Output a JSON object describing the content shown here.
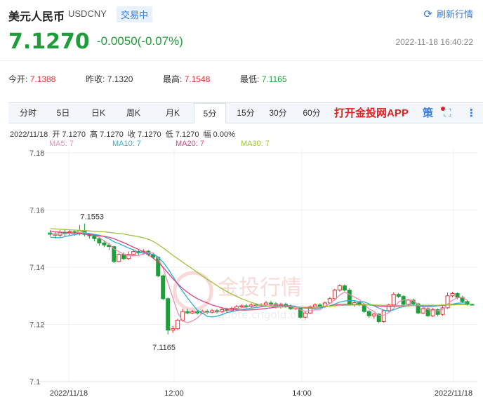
{
  "header": {
    "name": "美元人民币",
    "code": "USDCNY",
    "status": "交易中",
    "refresh_label": "刷新行情",
    "price": "7.1270",
    "change": "-0.0050(-0.07%)",
    "datetime": "2022-11-18 16:40:22"
  },
  "stats": [
    {
      "label": "今开:",
      "value": "7.1388",
      "color": "#e03030"
    },
    {
      "label": "昨收:",
      "value": "7.1320",
      "color": "#333333"
    },
    {
      "label": "最高:",
      "value": "7.1548",
      "color": "#e03030"
    },
    {
      "label": "最低:",
      "value": "7.1165",
      "color": "#1e9e3a"
    }
  ],
  "tabs": [
    "分时",
    "5日",
    "日K",
    "周K",
    "月K",
    "5分",
    "15分",
    "30分",
    "60分"
  ],
  "active_tab": "5分",
  "app_promo": "打开金投网APP",
  "strategy_label": "策",
  "ohlc_line": "2022/11/18  开 7.1270  高 7.1270  收 7.1270  低 7.1270  幅 0.00%",
  "ma_labels": [
    {
      "text": "MA5: 7",
      "color": "#f08cb4"
    },
    {
      "text": "MA10: 7",
      "color": "#27b0d8"
    },
    {
      "text": "MA20: 7",
      "color": "#e0407a"
    },
    {
      "text": "MA30: 7",
      "color": "#9ec23a"
    }
  ],
  "watermark": {
    "main": "金投行情",
    "sub": "quote.cngold.org"
  },
  "chart_data": {
    "type": "candlestick",
    "title": "",
    "y_ticks": [
      "7.18",
      "7.16",
      "7.14",
      "7.12",
      "7.1"
    ],
    "ylim": [
      7.1,
      7.18
    ],
    "x_ticks": [
      "2022/11/18",
      "12:00",
      "14:00",
      "2022/11/18"
    ],
    "annotations": [
      {
        "text": "7.1553",
        "value": 7.1553
      },
      {
        "text": "7.1165",
        "value": 7.1165
      }
    ],
    "up_color": "#e03030",
    "down_color": "#1e9e3a",
    "candles": [
      {
        "o": 7.152,
        "c": 7.1515,
        "h": 7.153,
        "l": 7.1508
      },
      {
        "o": 7.1516,
        "c": 7.1512,
        "h": 7.1525,
        "l": 7.15
      },
      {
        "o": 7.1512,
        "c": 7.1522,
        "h": 7.153,
        "l": 7.1505
      },
      {
        "o": 7.1522,
        "c": 7.1518,
        "h": 7.1532,
        "l": 7.151
      },
      {
        "o": 7.1518,
        "c": 7.1524,
        "h": 7.1532,
        "l": 7.1512
      },
      {
        "o": 7.1524,
        "c": 7.152,
        "h": 7.153,
        "l": 7.151
      },
      {
        "o": 7.152,
        "c": 7.1528,
        "h": 7.1548,
        "l": 7.1512
      },
      {
        "o": 7.1528,
        "c": 7.1515,
        "h": 7.1553,
        "l": 7.1508
      },
      {
        "o": 7.1515,
        "c": 7.151,
        "h": 7.152,
        "l": 7.15
      },
      {
        "o": 7.151,
        "c": 7.15,
        "h": 7.1515,
        "l": 7.149
      },
      {
        "o": 7.15,
        "c": 7.1485,
        "h": 7.1505,
        "l": 7.1475
      },
      {
        "o": 7.1485,
        "c": 7.1478,
        "h": 7.1495,
        "l": 7.147
      },
      {
        "o": 7.1478,
        "c": 7.1472,
        "h": 7.1486,
        "l": 7.146
      },
      {
        "o": 7.1472,
        "c": 7.142,
        "h": 7.1475,
        "l": 7.1415
      },
      {
        "o": 7.142,
        "c": 7.1445,
        "h": 7.145,
        "l": 7.1418
      },
      {
        "o": 7.1445,
        "c": 7.143,
        "h": 7.1452,
        "l": 7.1425
      },
      {
        "o": 7.143,
        "c": 7.1445,
        "h": 7.1455,
        "l": 7.1425
      },
      {
        "o": 7.1445,
        "c": 7.1455,
        "h": 7.1462,
        "l": 7.144
      },
      {
        "o": 7.1455,
        "c": 7.145,
        "h": 7.1462,
        "l": 7.1442
      },
      {
        "o": 7.145,
        "c": 7.1456,
        "h": 7.1463,
        "l": 7.1443
      },
      {
        "o": 7.1456,
        "c": 7.1445,
        "h": 7.146,
        "l": 7.1438
      },
      {
        "o": 7.1445,
        "c": 7.1435,
        "h": 7.145,
        "l": 7.1428
      },
      {
        "o": 7.1435,
        "c": 7.137,
        "h": 7.1438,
        "l": 7.1365
      },
      {
        "o": 7.137,
        "c": 7.129,
        "h": 7.1375,
        "l": 7.1285
      },
      {
        "o": 7.129,
        "c": 7.118,
        "h": 7.1295,
        "l": 7.1165
      },
      {
        "o": 7.118,
        "c": 7.1185,
        "h": 7.1195,
        "l": 7.117
      },
      {
        "o": 7.1185,
        "c": 7.1215,
        "h": 7.122,
        "l": 7.118
      },
      {
        "o": 7.1215,
        "c": 7.1245,
        "h": 7.1255,
        "l": 7.121
      },
      {
        "o": 7.1245,
        "c": 7.124,
        "h": 7.1255,
        "l": 7.1235
      },
      {
        "o": 7.124,
        "c": 7.1244,
        "h": 7.125,
        "l": 7.1236
      },
      {
        "o": 7.1244,
        "c": 7.124,
        "h": 7.125,
        "l": 7.1234
      },
      {
        "o": 7.124,
        "c": 7.1246,
        "h": 7.1252,
        "l": 7.1236
      },
      {
        "o": 7.1246,
        "c": 7.1242,
        "h": 7.1252,
        "l": 7.1236
      },
      {
        "o": 7.1242,
        "c": 7.1248,
        "h": 7.1254,
        "l": 7.1238
      },
      {
        "o": 7.1248,
        "c": 7.1244,
        "h": 7.1254,
        "l": 7.1238
      },
      {
        "o": 7.1244,
        "c": 7.1252,
        "h": 7.1258,
        "l": 7.124
      },
      {
        "o": 7.1252,
        "c": 7.1248,
        "h": 7.1258,
        "l": 7.1242
      },
      {
        "o": 7.1248,
        "c": 7.1256,
        "h": 7.1262,
        "l": 7.1244
      },
      {
        "o": 7.1256,
        "c": 7.1262,
        "h": 7.1268,
        "l": 7.125
      },
      {
        "o": 7.1262,
        "c": 7.1265,
        "h": 7.127,
        "l": 7.1256
      },
      {
        "o": 7.1265,
        "c": 7.1262,
        "h": 7.1272,
        "l": 7.1256
      },
      {
        "o": 7.1262,
        "c": 7.1268,
        "h": 7.1274,
        "l": 7.1258
      },
      {
        "o": 7.1268,
        "c": 7.1265,
        "h": 7.1274,
        "l": 7.1258
      },
      {
        "o": 7.1265,
        "c": 7.1268,
        "h": 7.1274,
        "l": 7.126
      },
      {
        "o": 7.1268,
        "c": 7.1275,
        "h": 7.1282,
        "l": 7.1262
      },
      {
        "o": 7.1275,
        "c": 7.1272,
        "h": 7.1282,
        "l": 7.1266
      },
      {
        "o": 7.1272,
        "c": 7.1262,
        "h": 7.1278,
        "l": 7.1256
      },
      {
        "o": 7.1262,
        "c": 7.127,
        "h": 7.1276,
        "l": 7.1256
      },
      {
        "o": 7.127,
        "c": 7.1264,
        "h": 7.1276,
        "l": 7.1258
      },
      {
        "o": 7.1264,
        "c": 7.1255,
        "h": 7.127,
        "l": 7.125
      },
      {
        "o": 7.1255,
        "c": 7.126,
        "h": 7.1266,
        "l": 7.125
      },
      {
        "o": 7.126,
        "c": 7.1225,
        "h": 7.1262,
        "l": 7.122
      },
      {
        "o": 7.1225,
        "c": 7.124,
        "h": 7.1245,
        "l": 7.1222
      },
      {
        "o": 7.124,
        "c": 7.1262,
        "h": 7.1266,
        "l": 7.1236
      },
      {
        "o": 7.1262,
        "c": 7.1268,
        "h": 7.1274,
        "l": 7.1256
      },
      {
        "o": 7.1268,
        "c": 7.1262,
        "h": 7.1274,
        "l": 7.1256
      },
      {
        "o": 7.1262,
        "c": 7.1275,
        "h": 7.128,
        "l": 7.1258
      },
      {
        "o": 7.1275,
        "c": 7.129,
        "h": 7.1296,
        "l": 7.127
      },
      {
        "o": 7.129,
        "c": 7.132,
        "h": 7.1325,
        "l": 7.1285
      },
      {
        "o": 7.132,
        "c": 7.1335,
        "h": 7.134,
        "l": 7.1315
      },
      {
        "o": 7.1335,
        "c": 7.132,
        "h": 7.134,
        "l": 7.1315
      },
      {
        "o": 7.132,
        "c": 7.127,
        "h": 7.1326,
        "l": 7.1265
      },
      {
        "o": 7.127,
        "c": 7.1276,
        "h": 7.1282,
        "l": 7.1262
      },
      {
        "o": 7.1276,
        "c": 7.127,
        "h": 7.1282,
        "l": 7.1264
      },
      {
        "o": 7.127,
        "c": 7.1245,
        "h": 7.1274,
        "l": 7.124
      },
      {
        "o": 7.1245,
        "c": 7.123,
        "h": 7.125,
        "l": 7.1222
      },
      {
        "o": 7.123,
        "c": 7.1236,
        "h": 7.1242,
        "l": 7.122
      },
      {
        "o": 7.1236,
        "c": 7.121,
        "h": 7.124,
        "l": 7.1205
      },
      {
        "o": 7.121,
        "c": 7.1248,
        "h": 7.1252,
        "l": 7.1206
      },
      {
        "o": 7.1248,
        "c": 7.1268,
        "h": 7.1272,
        "l": 7.1244
      },
      {
        "o": 7.1268,
        "c": 7.1305,
        "h": 7.1312,
        "l": 7.1264
      },
      {
        "o": 7.1305,
        "c": 7.1298,
        "h": 7.131,
        "l": 7.1292
      },
      {
        "o": 7.1298,
        "c": 7.127,
        "h": 7.1302,
        "l": 7.1265
      },
      {
        "o": 7.127,
        "c": 7.1285,
        "h": 7.129,
        "l": 7.1262
      },
      {
        "o": 7.1285,
        "c": 7.1272,
        "h": 7.129,
        "l": 7.1266
      },
      {
        "o": 7.1272,
        "c": 7.124,
        "h": 7.1276,
        "l": 7.1236
      },
      {
        "o": 7.124,
        "c": 7.1255,
        "h": 7.126,
        "l": 7.1236
      },
      {
        "o": 7.1255,
        "c": 7.123,
        "h": 7.126,
        "l": 7.1226
      },
      {
        "o": 7.123,
        "c": 7.1252,
        "h": 7.1258,
        "l": 7.1226
      },
      {
        "o": 7.1252,
        "c": 7.1235,
        "h": 7.1256,
        "l": 7.1228
      },
      {
        "o": 7.1235,
        "c": 7.1258,
        "h": 7.1264,
        "l": 7.123
      },
      {
        "o": 7.1258,
        "c": 7.13,
        "h": 7.1312,
        "l": 7.1254
      },
      {
        "o": 7.13,
        "c": 7.1308,
        "h": 7.1314,
        "l": 7.1294
      },
      {
        "o": 7.1308,
        "c": 7.1295,
        "h": 7.1312,
        "l": 7.1288
      },
      {
        "o": 7.1295,
        "c": 7.128,
        "h": 7.13,
        "l": 7.1274
      },
      {
        "o": 7.128,
        "c": 7.127,
        "h": 7.1285,
        "l": 7.1266
      },
      {
        "o": 7.127,
        "c": 7.127,
        "h": 7.1272,
        "l": 7.1268
      }
    ],
    "ma": [
      {
        "name": "MA5",
        "color": "#f08cb4",
        "values": [
          7.1516,
          7.1514,
          7.1516,
          7.1517,
          7.1518,
          7.152,
          7.1522,
          7.1521,
          7.1517,
          7.1512,
          7.1504,
          7.1492,
          7.1481,
          7.1464,
          7.1455,
          7.1446,
          7.144,
          7.144,
          7.1441,
          7.1446,
          7.1452,
          7.145,
          7.1431,
          7.1397,
          7.1345,
          7.1293,
          7.1241,
          7.1212,
          7.1206,
          7.1212,
          7.1222,
          7.124,
          7.1242,
          7.1243,
          7.1243,
          7.1246,
          7.1247,
          7.125,
          7.1254,
          7.1258,
          7.126,
          7.1264,
          7.1265,
          7.1266,
          7.1268,
          7.1269,
          7.1268,
          7.1267,
          7.1266,
          7.1264,
          7.1261,
          7.1251,
          7.1246,
          7.1248,
          7.1251,
          7.1251,
          7.1264,
          7.1273,
          7.1286,
          7.1303,
          7.1313,
          7.1305,
          7.1296,
          7.1287,
          7.1271,
          7.1254,
          7.1246,
          7.1232,
          7.1232,
          7.1241,
          7.1256,
          7.1278,
          7.1286,
          7.1287,
          7.1283,
          7.127,
          7.126,
          7.1252,
          7.1248,
          7.1247,
          7.1253,
          7.1272,
          7.1285,
          7.1293,
          7.1295,
          7.1285
        ]
      },
      {
        "name": "MA10",
        "color": "#27b0d8",
        "values": [
          7.1505,
          7.1504,
          7.1503,
          7.1507,
          7.1511,
          7.1514,
          7.1517,
          7.1518,
          7.1518,
          7.1515,
          7.1512,
          7.1507,
          7.1499,
          7.1489,
          7.1483,
          7.1475,
          7.1467,
          7.1461,
          7.1452,
          7.145,
          7.1448,
          7.1445,
          7.1436,
          7.1418,
          7.1395,
          7.1368,
          7.134,
          7.1316,
          7.1292,
          7.127,
          7.125,
          7.124,
          7.1228,
          7.1226,
          7.1229,
          7.1234,
          7.1241,
          7.1245,
          7.1248,
          7.1251,
          7.1254,
          7.1257,
          7.1259,
          7.1261,
          7.1263,
          7.1265,
          7.1265,
          7.1266,
          7.1266,
          7.1266,
          7.1263,
          7.1259,
          7.1257,
          7.1256,
          7.1256,
          7.1257,
          7.1262,
          7.1265,
          7.1271,
          7.1278,
          7.1282,
          7.1283,
          7.1283,
          7.128,
          7.1279,
          7.1272,
          7.1265,
          7.1257,
          7.125,
          7.1246,
          7.1251,
          7.1258,
          7.1262,
          7.1266,
          7.1268,
          7.1266,
          7.1262,
          7.1262,
          7.1263,
          7.1265,
          7.1266,
          7.1268,
          7.1271,
          7.1274,
          7.1275,
          7.1275
        ]
      },
      {
        "name": "MA20",
        "color": "#e0407a",
        "values": [
          7.1525,
          7.1524,
          7.1523,
          7.1522,
          7.1521,
          7.152,
          7.1518,
          7.1516,
          7.1514,
          7.1512,
          7.151,
          7.1508,
          7.1505,
          7.15,
          7.1493,
          7.1486,
          7.1478,
          7.147,
          7.1462,
          7.1454,
          7.1444,
          7.1432,
          7.1418,
          7.14,
          7.138,
          7.136,
          7.1342,
          7.1326,
          7.1312,
          7.13,
          7.129,
          7.1282,
          7.1275,
          7.1268,
          7.1263,
          7.1258,
          7.1255,
          7.1253,
          7.1251,
          7.125,
          7.125,
          7.1251,
          7.1252,
          7.1254,
          7.1256,
          7.1258,
          7.126,
          7.1261,
          7.1262,
          7.1262,
          7.1261,
          7.126,
          7.1259,
          7.1259,
          7.126,
          7.1261,
          7.1263,
          7.1265,
          7.1267,
          7.127,
          7.1271,
          7.1271,
          7.127,
          7.127,
          7.1269,
          7.1268,
          7.1266,
          7.1264,
          7.1263,
          7.1262,
          7.1263,
          7.1264,
          7.1265,
          7.1265,
          7.1266,
          7.1266,
          7.1266,
          7.1266,
          7.1266,
          7.1266,
          7.1267,
          7.1268,
          7.1269,
          7.127,
          7.127,
          7.127
        ]
      },
      {
        "name": "MA30",
        "color": "#9ec23a",
        "values": [
          7.1535,
          7.1534,
          7.1533,
          7.1532,
          7.1531,
          7.153,
          7.1529,
          7.1528,
          7.1527,
          7.1526,
          7.1525,
          7.1524,
          7.1522,
          7.152,
          7.1518,
          7.1516,
          7.1513,
          7.151,
          7.1507,
          7.1503,
          7.1498,
          7.149,
          7.148,
          7.1468,
          7.1455,
          7.1442,
          7.143,
          7.1418,
          7.1406,
          7.1394,
          7.1382,
          7.137,
          7.1358,
          7.1347,
          7.1336,
          7.1325,
          7.1315,
          7.1306,
          7.1298,
          7.129,
          7.1283,
          7.1277,
          7.1272,
          7.1268,
          7.1265,
          7.1263,
          7.1262,
          7.1261,
          7.1261,
          7.1261,
          7.1261,
          7.126,
          7.126,
          7.126,
          7.1261,
          7.1262,
          7.1263,
          7.1264,
          7.1265,
          7.1266,
          7.1267,
          7.1268,
          7.1268,
          7.1268,
          7.1268,
          7.1268,
          7.1268,
          7.1267,
          7.1267,
          7.1266,
          7.1266,
          7.1266,
          7.1266,
          7.1266,
          7.1266,
          7.1267,
          7.1267,
          7.1267,
          7.1267,
          7.1267,
          7.1268,
          7.1268,
          7.1268,
          7.1269,
          7.1269,
          7.1269
        ]
      }
    ]
  }
}
